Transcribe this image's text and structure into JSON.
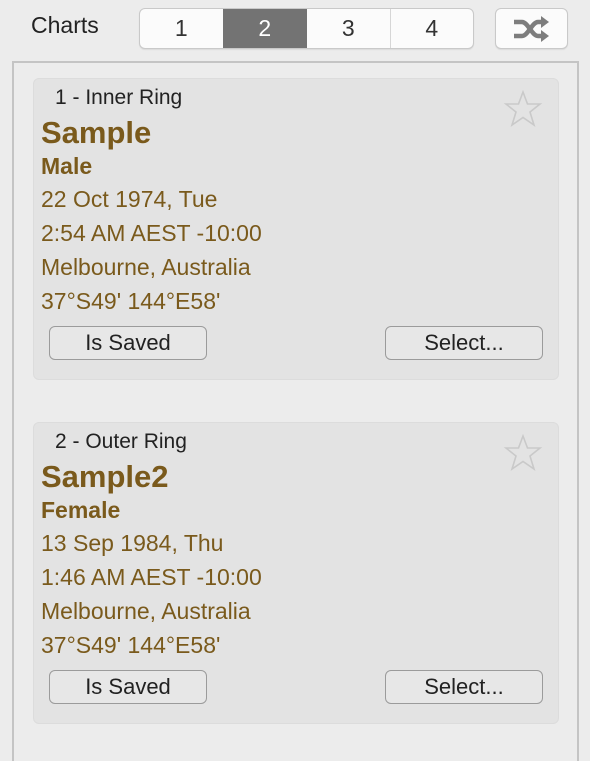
{
  "header": {
    "label": "Charts",
    "tabs": [
      {
        "label": "1",
        "active": false
      },
      {
        "label": "2",
        "active": true
      },
      {
        "label": "3",
        "active": false
      },
      {
        "label": "4",
        "active": false
      }
    ],
    "shuffle_icon": "shuffle-icon"
  },
  "charts": [
    {
      "ring_label": "1 - Inner Ring",
      "name": "Sample",
      "gender": "Male",
      "date": "22 Oct 1974, Tue",
      "time": "2:54 AM AEST -10:00",
      "place": "Melbourne, Australia",
      "coords": "37°S49' 144°E58'",
      "saved_label": "Is Saved",
      "select_label": "Select...",
      "favorite_icon": "star-outline-icon"
    },
    {
      "ring_label": "2 - Outer Ring",
      "name": "Sample2",
      "gender": "Female",
      "date": "13 Sep 1984, Thu",
      "time": "1:46 AM AEST -10:00",
      "place": "Melbourne, Australia",
      "coords": "37°S49' 144°E58'",
      "saved_label": "Is Saved",
      "select_label": "Select...",
      "favorite_icon": "star-outline-icon"
    }
  ],
  "colors": {
    "accent_text": "#7a5a1c",
    "active_tab": "#737373"
  }
}
